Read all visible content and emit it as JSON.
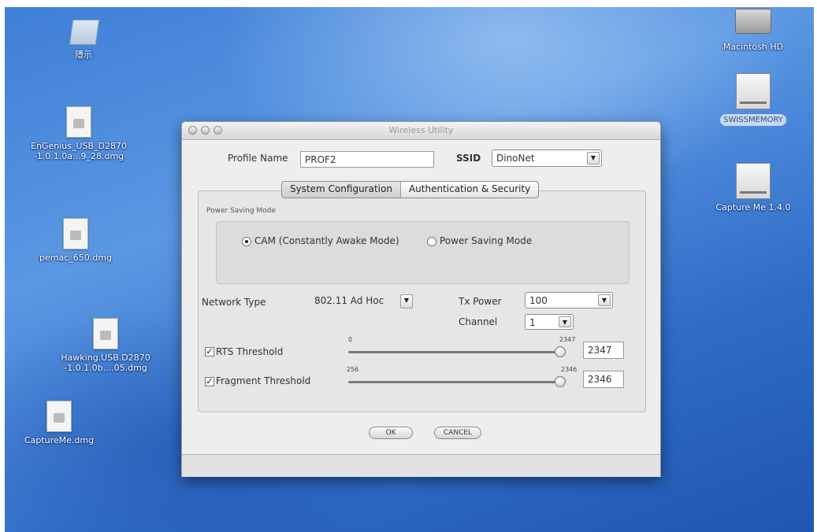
{
  "desktop": {
    "icons": [
      {
        "label": "隱示"
      },
      {
        "label": "EnGenius_USB_D2870\n-1.0.1.0a...9_28.dmg"
      },
      {
        "label": "pemac_650.dmg"
      },
      {
        "label": "Hawking.USB.D2870\n-1.0.1.0b....05.dmg"
      },
      {
        "label": "CaptureMe.dmg"
      },
      {
        "label": "Macintosh HD"
      },
      {
        "label": "SWISSMEMORY"
      },
      {
        "label": "Capture Me 1.4.0"
      }
    ]
  },
  "window": {
    "title": "Wireless Utility",
    "profile_label": "Profile Name",
    "profile_value": "PROF2",
    "ssid_label": "SSID",
    "ssid_value": "DinoNet",
    "tabs": [
      "System Configuration",
      "Authentication & Security"
    ],
    "active_tab": "System Configuration",
    "power_group_label": "Power Saving Mode",
    "radio_cam": "CAM (Constantly Awake Mode)",
    "radio_psm": "Power Saving Mode",
    "radio_selected": "CAM (Constantly Awake Mode)",
    "network_type_label": "Network Type",
    "network_type_value": "802.11 Ad Hoc",
    "tx_power_label": "Tx Power",
    "tx_power_value": "100",
    "channel_label": "Channel",
    "channel_value": "1",
    "rts_label": "RTS Threshold",
    "rts_checked": true,
    "rts_min": "0",
    "rts_max": "2347",
    "rts_value": "2347",
    "frag_label": "Fragment Threshold",
    "frag_checked": true,
    "frag_min": "256",
    "frag_max": "2346",
    "frag_value": "2346",
    "ok_label": "OK",
    "cancel_label": "CANCEL"
  }
}
